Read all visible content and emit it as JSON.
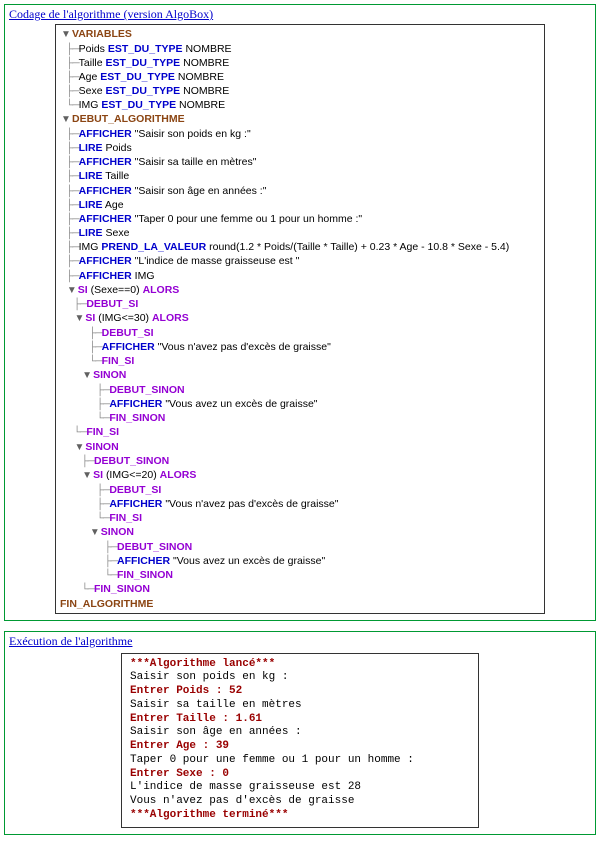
{
  "panel1": {
    "title": "Codage de l'algorithme (version AlgoBox)"
  },
  "panel2": {
    "title": "Exécution de l'algorithme"
  },
  "kw": {
    "variables": "VARIABLES",
    "est_du_type": "EST_DU_TYPE",
    "nombre": "NOMBRE",
    "debut_algo": "DEBUT_ALGORITHME",
    "afficher": "AFFICHER",
    "lire": "LIRE",
    "prend_la_valeur": "PREND_LA_VALEUR",
    "si": "SI",
    "alors": "ALORS",
    "debut_si": "DEBUT_SI",
    "fin_si": "FIN_SI",
    "sinon": "SINON",
    "debut_sinon": "DEBUT_SINON",
    "fin_sinon": "FIN_SINON",
    "fin_algo": "FIN_ALGORITHME"
  },
  "vars": {
    "poids": "Poids",
    "taille": "Taille",
    "age": "Age",
    "sexe": "Sexe",
    "img": "IMG"
  },
  "txt": {
    "saisir_poids": "\"Saisir son poids en kg :\"",
    "saisir_taille": "\"Saisir sa taille en mètres\"",
    "saisir_age": "\"Saisir son âge en années :\"",
    "taper_sexe": "\"Taper 0 pour une femme ou 1 pour un homme :\"",
    "formula": "round(1.2 * Poids/(Taille * Taille) + 0.23 * Age - 10.8 * Sexe - 5.4)",
    "indice_msg": "\"L'indice de masse graisseuse est \"",
    "cond_sexe": "(Sexe==0)",
    "cond_img30": "(IMG<=30)",
    "cond_img20": "(IMG<=20)",
    "no_excess": "\"Vous n'avez pas d'excès de graisse\"",
    "excess": "\"Vous avez un excès de graisse\""
  },
  "exec": {
    "l1": "***Algorithme lancé***",
    "l2": "Saisir son poids en kg :",
    "l3": "Entrer Poids : 52",
    "l4": "Saisir sa taille en mètres",
    "l5": "Entrer Taille : 1.61",
    "l6": "Saisir son âge en années :",
    "l7": "Entrer Age : 39",
    "l8": "Taper 0 pour une femme ou 1 pour un homme :",
    "l9": "Entrer Sexe : 0",
    "l10": "L'indice de masse graisseuse est 28",
    "l11": "Vous n'avez pas d'excès de graisse",
    "l12": "***Algorithme terminé***"
  }
}
